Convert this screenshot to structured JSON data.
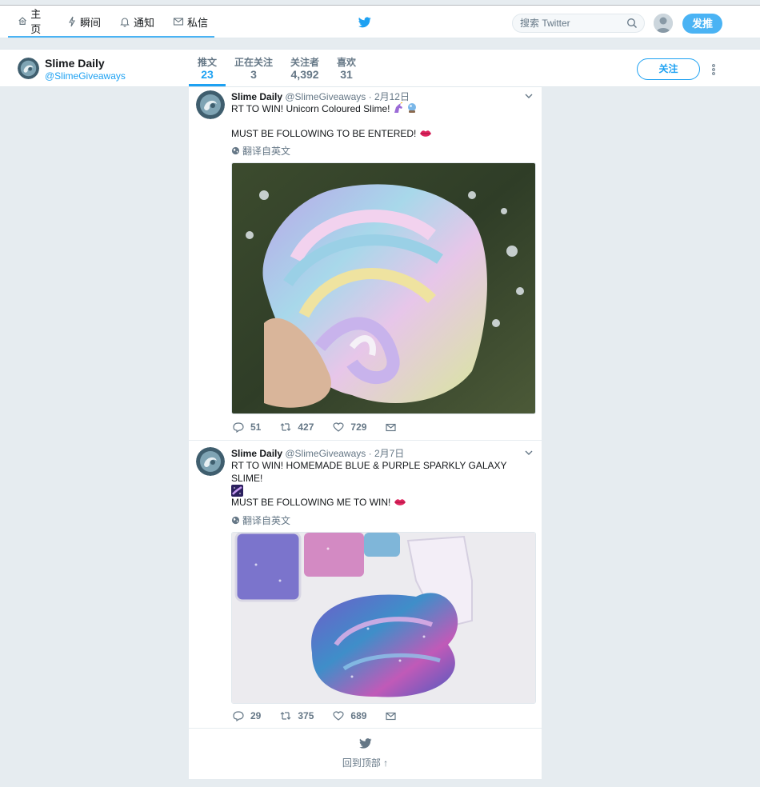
{
  "nav": {
    "items": [
      {
        "label": "主页",
        "icon": "home-icon"
      },
      {
        "label": "瞬间",
        "icon": "lightning-icon"
      },
      {
        "label": "通知",
        "icon": "bell-icon"
      },
      {
        "label": "私信",
        "icon": "envelope-icon"
      }
    ],
    "search_placeholder": "搜索 Twitter",
    "tweet_button": "发推"
  },
  "profile": {
    "name": "Slime Daily",
    "handle": "@SlimeGiveaways",
    "stats": [
      {
        "label": "推文",
        "value": "23",
        "active": true
      },
      {
        "label": "正在关注",
        "value": "3"
      },
      {
        "label": "关注者",
        "value": "4,392"
      },
      {
        "label": "喜欢",
        "value": "31"
      }
    ],
    "follow_button": "关注"
  },
  "tweets": [
    {
      "name": "Slime Daily",
      "handle": "@SlimeGiveaways",
      "date": "2月12日",
      "line1": "RT TO WIN! Unicorn Coloured Slime! ",
      "line2": "MUST BE FOLLOWING TO BE ENTERED! ",
      "translate": "翻译自英文",
      "replies": "51",
      "retweets": "427",
      "likes": "729"
    },
    {
      "name": "Slime Daily",
      "handle": "@SlimeGiveaways",
      "date": "2月7日",
      "line1": "RT TO WIN! HOMEMADE BLUE & PURPLE SPARKLY GALAXY SLIME!",
      "line2": "MUST BE FOLLOWING ME TO WIN! ",
      "translate": "翻译自英文",
      "replies": "29",
      "retweets": "375",
      "likes": "689"
    }
  ],
  "back_to_top": "回到顶部 ↑",
  "colors": {
    "accent": "#1da1f2",
    "nav_accent": "#4ab3f4",
    "background": "#e6ecf0"
  }
}
